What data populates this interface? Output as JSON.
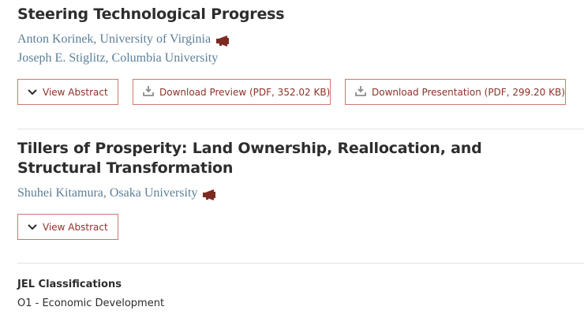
{
  "articles": [
    {
      "title": "Steering Technological Progress",
      "authors": [
        "Anton Korinek, University of Virginia",
        "Joseph E. Stiglitz, Columbia University"
      ],
      "buttons": {
        "abstract": "View Abstract",
        "preview": "Download Preview (PDF, 352.02 KB)",
        "presentation": "Download Presentation (PDF, 299.20 KB)"
      }
    },
    {
      "title": "Tillers of Prosperity: Land Ownership, Reallocation, and Structural Transformation",
      "authors": [
        "Shuhei Kitamura, Osaka University"
      ],
      "buttons": {
        "abstract": "View Abstract"
      }
    }
  ],
  "jel": {
    "heading": "JEL Classifications",
    "items": [
      "O1 - Economic Development"
    ]
  },
  "icons": {
    "abstract": "chevron-down-icon",
    "download": "download-tray-icon",
    "presenter": "megaphone-icon"
  },
  "colors": {
    "button_border": "#c97a70",
    "button_text": "#8b3228",
    "author_link": "#5b7f98",
    "megaphone": "#7d2a22"
  }
}
